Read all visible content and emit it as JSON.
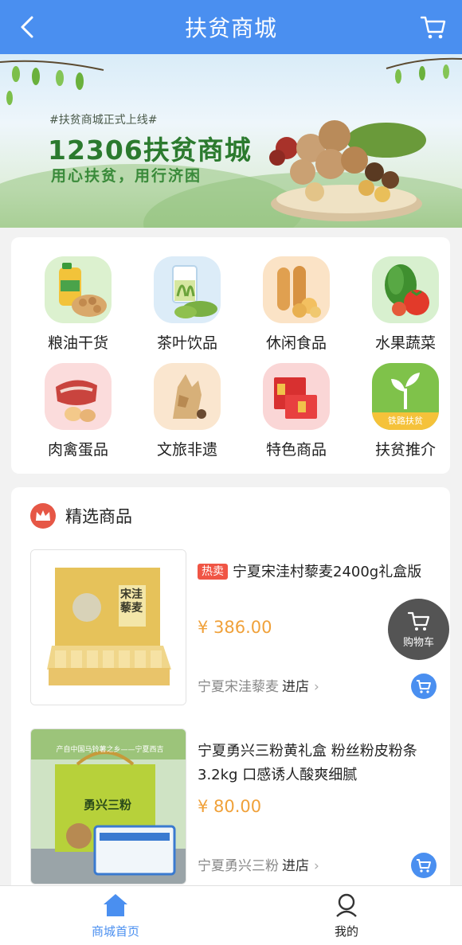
{
  "header": {
    "title": "扶贫商城"
  },
  "banner": {
    "tag": "#扶贫商城正式上线#",
    "headline": "12306扶贫商城",
    "slogan": "用心扶贫，用行济困"
  },
  "categories": [
    {
      "label": "粮油干货",
      "icon": "grain-oil-icon"
    },
    {
      "label": "茶叶饮品",
      "icon": "tea-icon"
    },
    {
      "label": "休闲食品",
      "icon": "snack-icon"
    },
    {
      "label": "水果蔬菜",
      "icon": "vegetable-icon"
    },
    {
      "label": "肉禽蛋品",
      "icon": "meat-egg-icon"
    },
    {
      "label": "文旅非遗",
      "icon": "culture-icon"
    },
    {
      "label": "特色商品",
      "icon": "gift-box-icon"
    },
    {
      "label": "扶贫推介",
      "icon": "sprout-icon",
      "badge": "铁路扶贫"
    }
  ],
  "featured": {
    "title": "精选商品",
    "products": [
      {
        "badge": "热卖",
        "name": "宁夏宋洼村藜麦2400g礼盒版",
        "price": "¥ 386.00",
        "store": "宁夏宋洼藜麦",
        "store_link": "进店",
        "image_text": "宋洼藜麦"
      },
      {
        "name": "宁夏勇兴三粉黄礼盒 粉丝粉皮粉条3.2kg 口感诱人酸爽细腻",
        "price": "¥ 80.00",
        "store": "宁夏勇兴三粉",
        "store_link": "进店",
        "image_text": "勇兴三粉",
        "image_tagline": "产自中国马铃薯之乡——宁夏西吉"
      }
    ]
  },
  "float_cart": {
    "label": "购物车"
  },
  "bottom_nav": {
    "home": "商城首页",
    "mine": "我的"
  },
  "colors": {
    "primary": "#4a8ff0",
    "price": "#f0a13a",
    "hot": "#f05545"
  }
}
